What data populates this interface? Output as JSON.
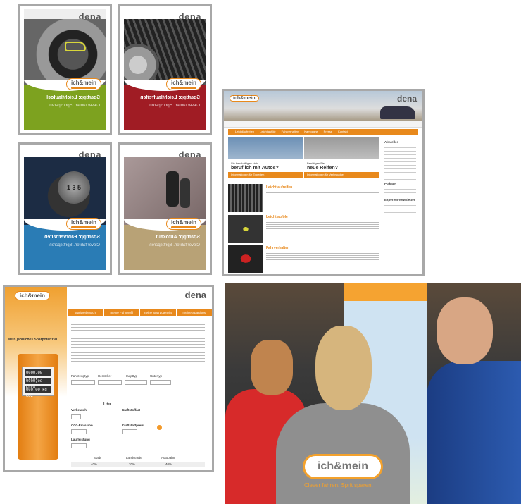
{
  "brand": {
    "dena": "dena",
    "ichmein": "ich&mein"
  },
  "cards": [
    {
      "title": "Spartipp: Leichtlaufoel",
      "subtitle": "Clever fahren. Sprit sparen.",
      "color": "#7da21f",
      "photo": "oil-cap"
    },
    {
      "title": "Spartipp: Leichtlaufreifen",
      "subtitle": "Clever fahren. Sprit sparen.",
      "color": "#a01c24",
      "photo": "tire"
    },
    {
      "title": "Spartipp: Fahrverhalten",
      "subtitle": "Clever fahren. Sprit sparen.",
      "color": "#2a7cb5",
      "photo": "gear-knob"
    },
    {
      "title": "Spartipp: Autokauf",
      "subtitle": "Clever fahren. Sprit sparen.",
      "color": "#b8a276",
      "photo": "car-keys"
    }
  ],
  "website": {
    "teaser_left": {
      "small": "Sie beschäftigen sich",
      "big": "beruflich mit Autos?",
      "btn": "Informationen für Experten"
    },
    "teaser_right": {
      "small": "Benötigen Sie",
      "big": "neue Reifen?",
      "btn": "Informationen für Verbraucher"
    },
    "articles": [
      "Leichtlaufreifen",
      "Leichtlauföle",
      "Fahrverhalten"
    ],
    "sidebar": {
      "title": "Aktuelles",
      "item2": "Plakate",
      "item3": "Experten-Newsletter"
    },
    "menu": [
      "Leichtlaufreifen",
      "Leichtlauföle",
      "Fahrverhalten",
      "Kampagne",
      "Presse",
      "Kontakt"
    ]
  },
  "calculator": {
    "heading": "Mein jährliches Sparpotenzial",
    "tabs": [
      "Spritverbrauch",
      "meine Fahrprofil",
      "meine Sparpotenzial",
      "meine Spartipps"
    ],
    "pump": {
      "row1": "0000,00 Liter",
      "row2": "0000,00 Euro",
      "row3": "000,00 kg CO2"
    },
    "fields": {
      "fahrzeugtyp": "Fahrzeugtyp",
      "hersteller": "Hersteller",
      "haupttyp": "Haupttyp",
      "untertyp": "Untertyp",
      "verbrauch": "Verbrauch",
      "kraftstoff": "Kraftstoffart",
      "co2": "CO2-Emission",
      "preis": "Kraftstoffpreis",
      "laufleistung": "Laufleistung",
      "liter": "Liter",
      "stadt": "Stadt",
      "landstr": "Landstraße",
      "autobahn": "Autobahn"
    },
    "pct": [
      "40%",
      "20%",
      "40%"
    ]
  },
  "photo": {
    "shirt_logo": "ich&mein",
    "shirt_slogan": "Clever fahren. Sprit sparen."
  }
}
